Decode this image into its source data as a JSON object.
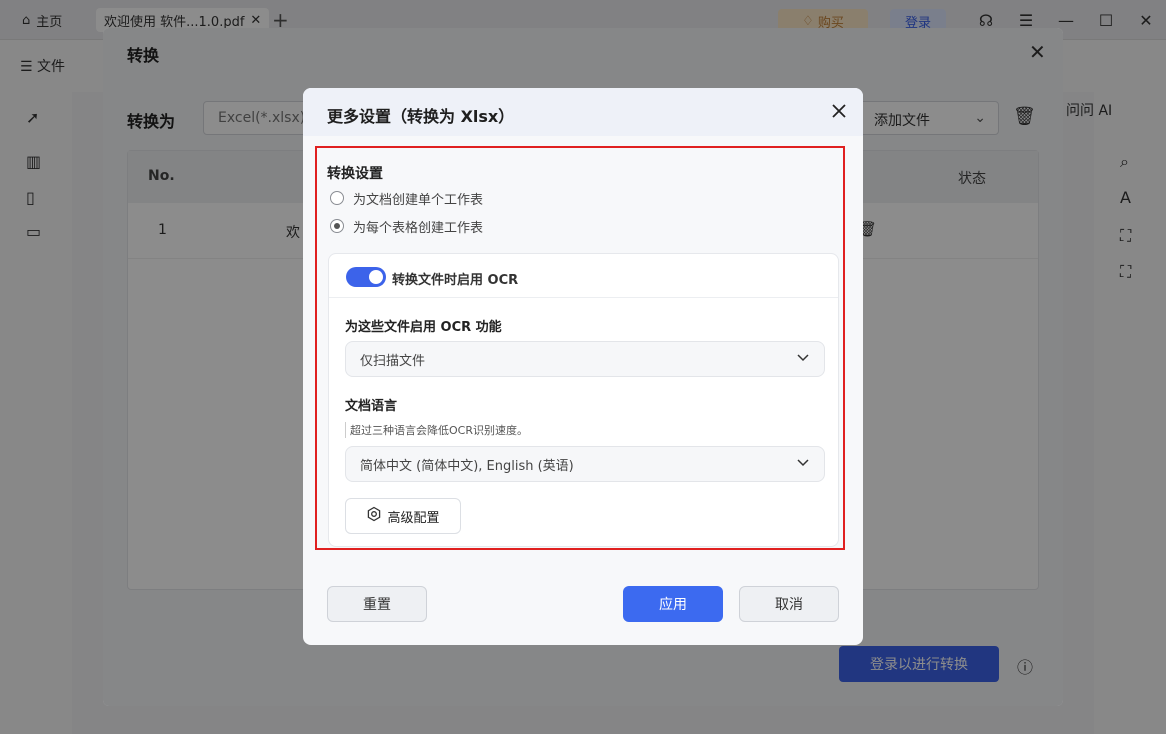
{
  "app": {
    "tabs": [
      {
        "label": "主页"
      },
      {
        "label": "欢迎使用 软件...1.0.pdf"
      }
    ],
    "buy_label": "购买",
    "login_label": "登录",
    "file_menu": "文件",
    "ask_ai": "问问 AI"
  },
  "convert_dialog": {
    "title": "转换",
    "convert_to_label": "转换为",
    "format_value": "Excel(*.xlsx)",
    "add_file_label": "添加文件",
    "table_headers": {
      "no": "No.",
      "status": "状态"
    },
    "rows": [
      {
        "no": "1",
        "name": "欢"
      }
    ],
    "submit_label": "登录以进行转换"
  },
  "settings_dialog": {
    "title": "更多设置（转换为 Xlsx）",
    "section_title": "转换设置",
    "radio_options": [
      {
        "label": "为文档创建单个工作表",
        "checked": false
      },
      {
        "label": "为每个表格创建工作表",
        "checked": true
      }
    ],
    "ocr_toggle_label": "转换文件时启用 OCR",
    "ocr_toggle_on": true,
    "ocr_scope_label": "为这些文件启用 OCR 功能",
    "ocr_scope_value": "仅扫描文件",
    "language_label": "文档语言",
    "language_hint": "超过三种语言会降低OCR识别速度。",
    "language_value": "简体中文 (简体中文), English (英语)",
    "advanced_label": "高级配置",
    "reset_label": "重置",
    "apply_label": "应用",
    "cancel_label": "取消"
  },
  "colors": {
    "accent": "#3c6af0",
    "highlight_border": "#e02020"
  }
}
